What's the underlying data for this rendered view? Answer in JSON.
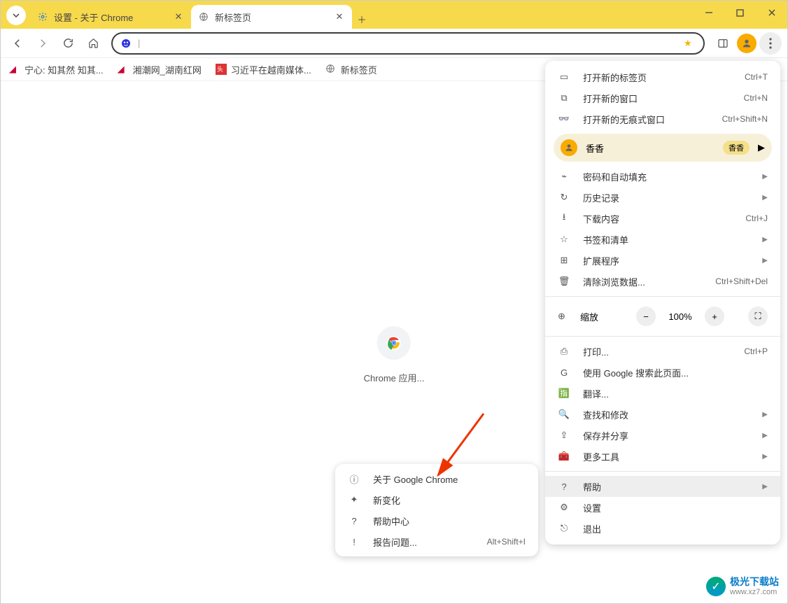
{
  "tabs": [
    {
      "title": "设置 - 关于 Chrome",
      "icon": "gear"
    },
    {
      "title": "新标签页",
      "icon": "globe"
    }
  ],
  "bookmarks": [
    {
      "label": "宁心: 知其然 知其...",
      "icon_color": "#c03"
    },
    {
      "label": "湘潮网_湖南红网",
      "icon_color": "#c03"
    },
    {
      "label": "习近平在越南媒体...",
      "icon_color": "#d33",
      "badge": "头条"
    },
    {
      "label": "新标签页",
      "icon_color": "#666"
    }
  ],
  "apps_label": "Chrome 应用...",
  "omnibox_placeholder": "",
  "menu": {
    "new_tab": {
      "label": "打开新的标签页",
      "shortcut": "Ctrl+T"
    },
    "new_window": {
      "label": "打开新的窗口",
      "shortcut": "Ctrl+N"
    },
    "incognito": {
      "label": "打开新的无痕式窗口",
      "shortcut": "Ctrl+Shift+N"
    },
    "profile": {
      "name": "香香",
      "badge": "香香"
    },
    "passwords": {
      "label": "密码和自动填充"
    },
    "history": {
      "label": "历史记录"
    },
    "downloads": {
      "label": "下载内容",
      "shortcut": "Ctrl+J"
    },
    "bookmarks": {
      "label": "书签和清单"
    },
    "extensions": {
      "label": "扩展程序"
    },
    "clear": {
      "label": "清除浏览数据...",
      "shortcut": "Ctrl+Shift+Del"
    },
    "zoom": {
      "label": "缩放",
      "value": "100%"
    },
    "print": {
      "label": "打印...",
      "shortcut": "Ctrl+P"
    },
    "search": {
      "label": "使用 Google 搜索此页面..."
    },
    "translate": {
      "label": "翻译..."
    },
    "find": {
      "label": "查找和修改"
    },
    "share": {
      "label": "保存并分享"
    },
    "moretools": {
      "label": "更多工具"
    },
    "help": {
      "label": "帮助"
    },
    "settings": {
      "label": "设置"
    },
    "exit": {
      "label": "退出"
    }
  },
  "submenu": {
    "about": {
      "label": "关于 Google Chrome"
    },
    "new": {
      "label": "新变化"
    },
    "helpcenter": {
      "label": "帮助中心"
    },
    "report": {
      "label": "报告问题...",
      "shortcut": "Alt+Shift+I"
    }
  },
  "watermark": {
    "line1": "极光下载站",
    "line2": "www.xz7.com"
  }
}
